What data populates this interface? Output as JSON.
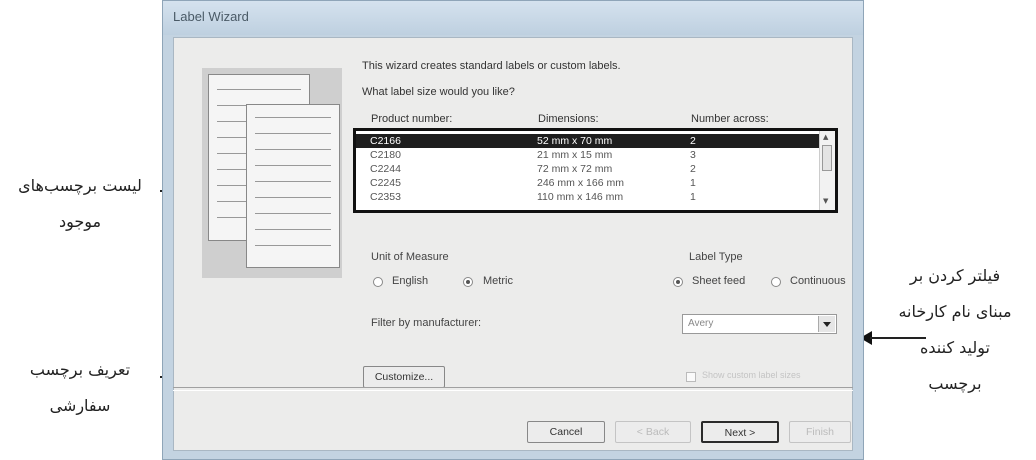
{
  "callouts": {
    "label_list": [
      "لیست برچسب‌های",
      "موجود"
    ],
    "custom_label": [
      "تعریف برچسب",
      "سفارشی"
    ],
    "filter": [
      "فیلتر کردن بر",
      "مبنای نام کارخانه",
      "تولید کننده",
      "برچسب"
    ]
  },
  "dialog": {
    "title": "Label Wizard",
    "intro": "This wizard creates standard labels or custom labels.",
    "question": "What label size would you like?",
    "columns": [
      "Product number:",
      "Dimensions:",
      "Number across:"
    ],
    "rows": [
      {
        "product": "C2166",
        "dimensions": "52 mm x 70 mm",
        "across": "2"
      },
      {
        "product": "C2180",
        "dimensions": "21 mm x 15 mm",
        "across": "3"
      },
      {
        "product": "C2244",
        "dimensions": "72 mm x 72 mm",
        "across": "2"
      },
      {
        "product": "C2245",
        "dimensions": "246 mm x 166 mm",
        "across": "1"
      },
      {
        "product": "C2353",
        "dimensions": "110 mm x 146 mm",
        "across": "1"
      }
    ],
    "unit_label": "Unit of Measure",
    "unit_options": [
      "English",
      "Metric"
    ],
    "unit_selected": "Metric",
    "type_label": "Label Type",
    "type_options": [
      "Sheet feed",
      "Continuous"
    ],
    "type_selected": "Sheet feed",
    "filter_label": "Filter by manufacturer:",
    "filter_value": "Avery",
    "customize_button": "Customize...",
    "show_custom_label": "Show custom label sizes",
    "buttons": {
      "cancel": "Cancel",
      "back": "< Back",
      "next": "Next >",
      "finish": "Finish"
    }
  }
}
